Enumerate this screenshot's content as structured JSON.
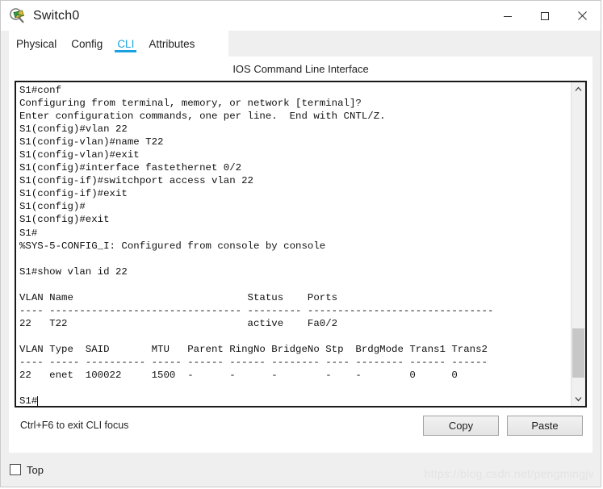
{
  "window": {
    "title": "Switch0",
    "icon": "packet-tracer-device-icon",
    "controls": {
      "minimize": "—",
      "maximize": "□",
      "close": "✕"
    }
  },
  "tabs": [
    {
      "label": "Physical",
      "active": false
    },
    {
      "label": "Config",
      "active": false
    },
    {
      "label": "CLI",
      "active": true
    },
    {
      "label": "Attributes",
      "active": false
    }
  ],
  "panel": {
    "heading": "IOS Command Line Interface",
    "hint": "Ctrl+F6 to exit CLI focus",
    "copy_label": "Copy",
    "paste_label": "Paste"
  },
  "terminal": {
    "text": "S1#conf\nConfiguring from terminal, memory, or network [terminal]?\nEnter configuration commands, one per line.  End with CNTL/Z.\nS1(config)#vlan 22\nS1(config-vlan)#name T22\nS1(config-vlan)#exit\nS1(config)#interface fastethernet 0/2\nS1(config-if)#switchport access vlan 22\nS1(config-if)#exit\nS1(config)#\nS1(config)#exit\nS1#\n%SYS-5-CONFIG_I: Configured from console by console\n\nS1#show vlan id 22\n\nVLAN Name                             Status    Ports\n---- -------------------------------- --------- -------------------------------\n22   T22                              active    Fa0/2\n\nVLAN Type  SAID       MTU   Parent RingNo BridgeNo Stp  BrdgMode Trans1 Trans2\n---- ----- ---------- ----- ------ ------ -------- ---- -------- ------ ------\n22   enet  100022     1500  -      -      -        -    -        0      0\n\nS1#",
    "prompt_last": "S1#"
  },
  "scrollbar": {
    "up_arrow": "∧",
    "down_arrow": "∨",
    "thumb_position_pct": 78,
    "thumb_size_pct": 17
  },
  "bottom": {
    "top_checkbox_label": "Top",
    "top_checked": false
  },
  "watermark": "https://blog.csdn.net/pengmingjv",
  "colors": {
    "accent": "#1ba1e2",
    "terminal_border": "#1a1a1a",
    "window_bg": "#efefef",
    "panel_bg": "#ffffff"
  }
}
